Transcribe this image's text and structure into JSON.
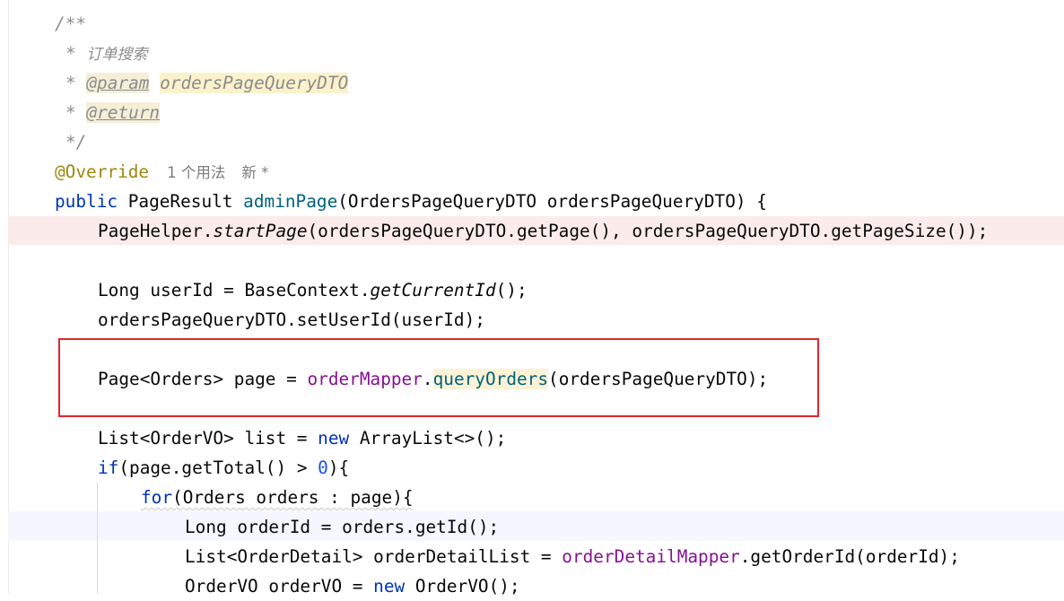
{
  "editor": {
    "doc_comment": {
      "open": "/**",
      "star": "*",
      "description": "订单搜索",
      "param_tag": "@param",
      "param_name": "ordersPageQueryDTO",
      "return_tag": "@return",
      "close": "*/"
    },
    "annotation": "@Override",
    "inlay_usages": "1 个用法",
    "inlay_new": "新 *",
    "kw_public": "public",
    "return_type": "PageResult",
    "method_name": "adminPage",
    "method_params": "(OrdersPageQueryDTO ordersPageQueryDTO) {",
    "line_pagehelper": {
      "cls": "PageHelper.",
      "method": "startPage",
      "args": "(ordersPageQueryDTO.getPage(), ordersPageQueryDTO.getPageSize());"
    },
    "line_userid": {
      "decl": "Long userId = BaseContext.",
      "method": "getCurrentId",
      "tail": "();"
    },
    "line_setuserid": "ordersPageQueryDTO.setUserId(userId);",
    "line_page": {
      "decl": "Page<Orders> page = ",
      "field": "orderMapper",
      "dot": ".",
      "method": "queryOrders",
      "args": "(ordersPageQueryDTO);"
    },
    "line_list": {
      "decl": "List<OrderVO> list = ",
      "kw": "new",
      "rest": " ArrayList<>();"
    },
    "line_if": {
      "kw": "if",
      "cond": "(page.getTotal() > ",
      "num": "0",
      "tail": "){"
    },
    "line_for": {
      "kw": "for",
      "rest": "(Orders orders : page){"
    },
    "line_orderid": "Long orderId = orders.getId();",
    "line_detail": {
      "decl": "List<OrderDetail> orderDetailList = ",
      "field": "orderDetailMapper",
      "rest": ".getOrderId(orderId);"
    },
    "line_ordervo": {
      "decl": "OrderVO orderVO = ",
      "kw": "new",
      "rest": " OrderVO();"
    }
  },
  "colors": {
    "keyword": "#0033b3",
    "method_declaration": "#00627a",
    "field": "#871094",
    "number": "#1750eb",
    "annotation": "#9e880d",
    "comment": "#8c8c8c",
    "selection_box": "#e0262d"
  }
}
